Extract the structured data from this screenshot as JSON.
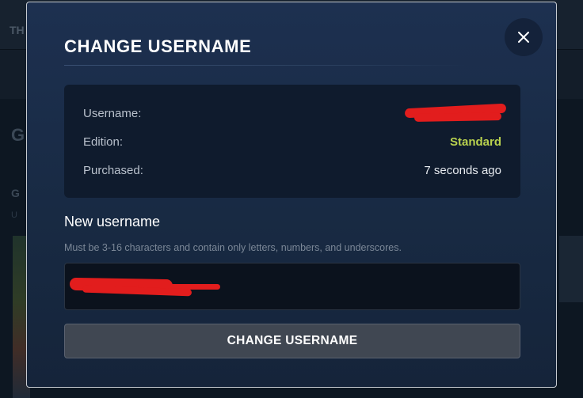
{
  "background": {
    "nav_text": "TH"
  },
  "modal": {
    "title": "CHANGE USERNAME",
    "close_icon": "close-icon",
    "info": {
      "username_label": "Username:",
      "username_value": "",
      "edition_label": "Edition:",
      "edition_value": "Standard",
      "purchased_label": "Purchased:",
      "purchased_value": "7 seconds ago"
    },
    "new_username_label": "New username",
    "new_username_hint": "Must be 3-16 characters and contain only letters, numbers, and underscores.",
    "new_username_value": "",
    "submit_label": "CHANGE USERNAME"
  },
  "colors": {
    "modal_bg": "#1d3050",
    "card_bg": "#0f1b2d",
    "edition_accent": "#b9d24e",
    "button_bg": "#404752",
    "redaction": "#e21d1d"
  }
}
